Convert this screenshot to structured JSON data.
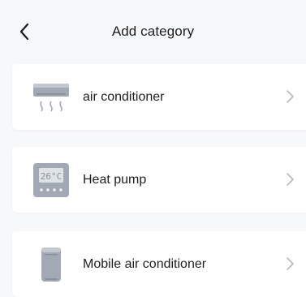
{
  "header": {
    "title": "Add category",
    "back_icon": "chevron-left-icon"
  },
  "categories": [
    {
      "label": "air conditioner",
      "icon": "air-conditioner-icon"
    },
    {
      "label": "Heat pump",
      "icon": "heat-pump-thermostat-icon",
      "display_text": "26°C"
    },
    {
      "label": "Mobile air conditioner",
      "icon": "mobile-air-conditioner-icon"
    }
  ],
  "colors": {
    "background": "#f7f8fa",
    "card": "#ffffff",
    "icon_gray": "#9aa0ab",
    "chevron": "#b8b8b8"
  }
}
